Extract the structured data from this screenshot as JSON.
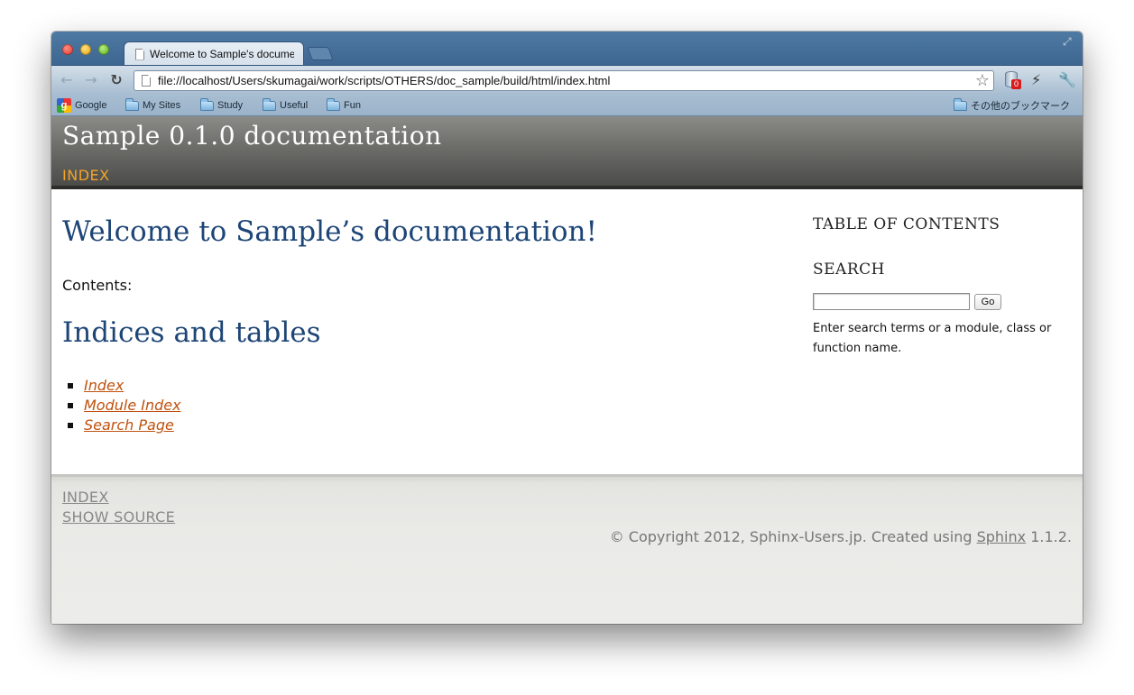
{
  "browser": {
    "tab_title": "Welcome to Sample's documentation",
    "url": "file://localhost/Users/skumagai/work/scripts/OTHERS/doc_sample/build/html/index.html",
    "extension_badge": "0",
    "bookmarks": [
      "Google",
      "My Sites",
      "Study",
      "Useful",
      "Fun"
    ],
    "other_bookmarks": "その他のブックマーク"
  },
  "header": {
    "site_title": "Sample 0.1.0 documentation",
    "nav_index": "INDEX"
  },
  "main": {
    "title": "Welcome to Sample’s documentation!",
    "contents_label": "Contents:",
    "indices_title": "Indices and tables",
    "links": [
      "Index",
      "Module Index",
      "Search Page"
    ]
  },
  "sidebar": {
    "toc_title": "TABLE OF CONTENTS",
    "search_title": "SEARCH",
    "go_label": "Go",
    "search_help": "Enter search terms or a module, class or function name."
  },
  "footer": {
    "index_link": "INDEX",
    "show_source_link": "SHOW SOURCE",
    "copyright_prefix": "© Copyright 2012, Sphinx-Users.jp. Created using ",
    "sphinx_link": "Sphinx",
    "version_suffix": " 1.1.2."
  },
  "colors": {
    "link": "#c0520f",
    "heading": "#1d4576",
    "header_nav": "#f3a32a"
  }
}
